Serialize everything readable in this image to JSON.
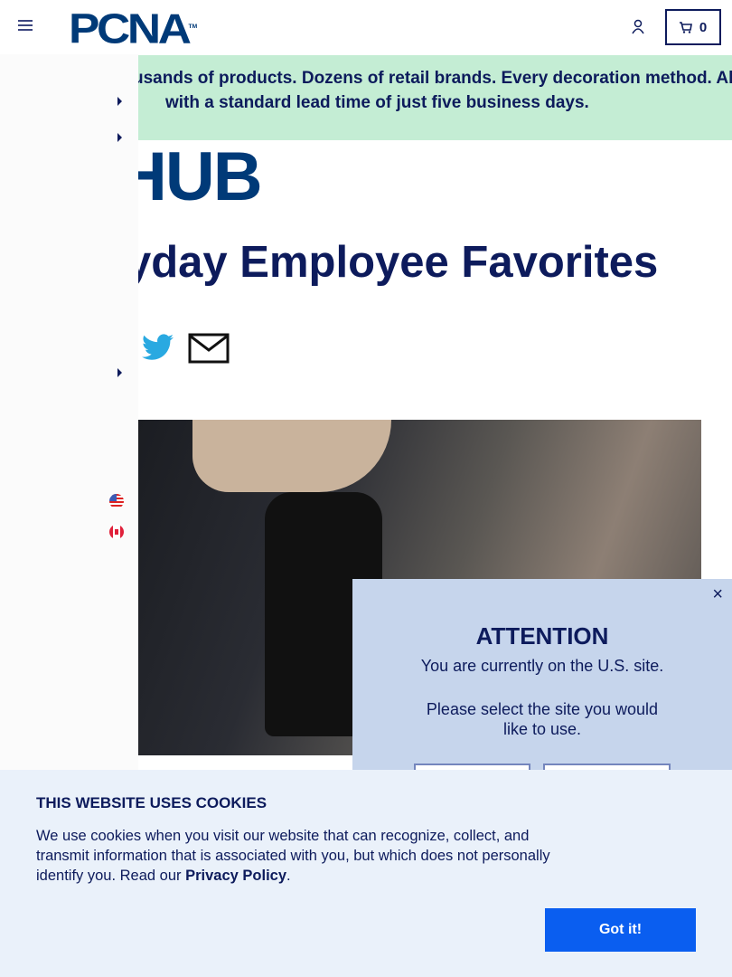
{
  "header": {
    "logo": "PCNA",
    "logo_tm": "TM",
    "cart_count": "0"
  },
  "banner": {
    "line1": "usands of products. Dozens of retail brands. Every decoration method. All",
    "line2": "with a standard lead time of just five business days."
  },
  "hub_logo": "HUB",
  "page_title": "yday Employee Favorites",
  "modal": {
    "close": "×",
    "title": "ATTENTION",
    "line1": "You are currently on the U.S. site.",
    "line2": "Please select the site you would like to use."
  },
  "cookie": {
    "title": "THIS WEBSITE USES COOKIES",
    "text": "We use cookies when you visit our website that can recognize, collect, and transmit information that is associated with you, but which does not personally identify you. Read our ",
    "link": "Privacy Policy",
    "end": ".",
    "button": "Got it!"
  },
  "colors": {
    "navy": "#0d1b5c",
    "banner": "#c4edd4",
    "modal": "#c6d5ec",
    "cookie_button": "#0a5ef0",
    "twitter": "#1da1f2"
  }
}
